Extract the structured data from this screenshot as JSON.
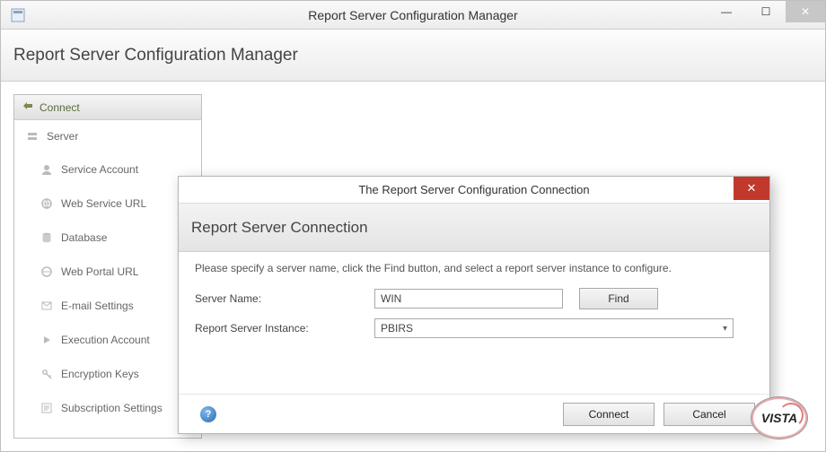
{
  "window": {
    "title": "Report Server Configuration Manager",
    "min": "—",
    "max": "☐",
    "close": "✕"
  },
  "page_header": "Report Server Configuration Manager",
  "sidebar": {
    "connect": "Connect",
    "server": "Server",
    "items": [
      "Service Account",
      "Web Service URL",
      "Database",
      "Web Portal URL",
      "E-mail Settings",
      "Execution Account",
      "Encryption Keys",
      "Subscription Settings"
    ]
  },
  "dialog": {
    "title": "The Report Server Configuration Connection",
    "header": "Report Server Connection",
    "instruction": "Please specify a server name, click the Find button, and select a report server instance to configure.",
    "server_name_label": "Server Name:",
    "server_name_value": "WIN",
    "find_label": "Find",
    "instance_label": "Report Server Instance:",
    "instance_value": "PBIRS",
    "help": "?",
    "connect": "Connect",
    "cancel": "Cancel"
  },
  "logo_text": "VISTA"
}
